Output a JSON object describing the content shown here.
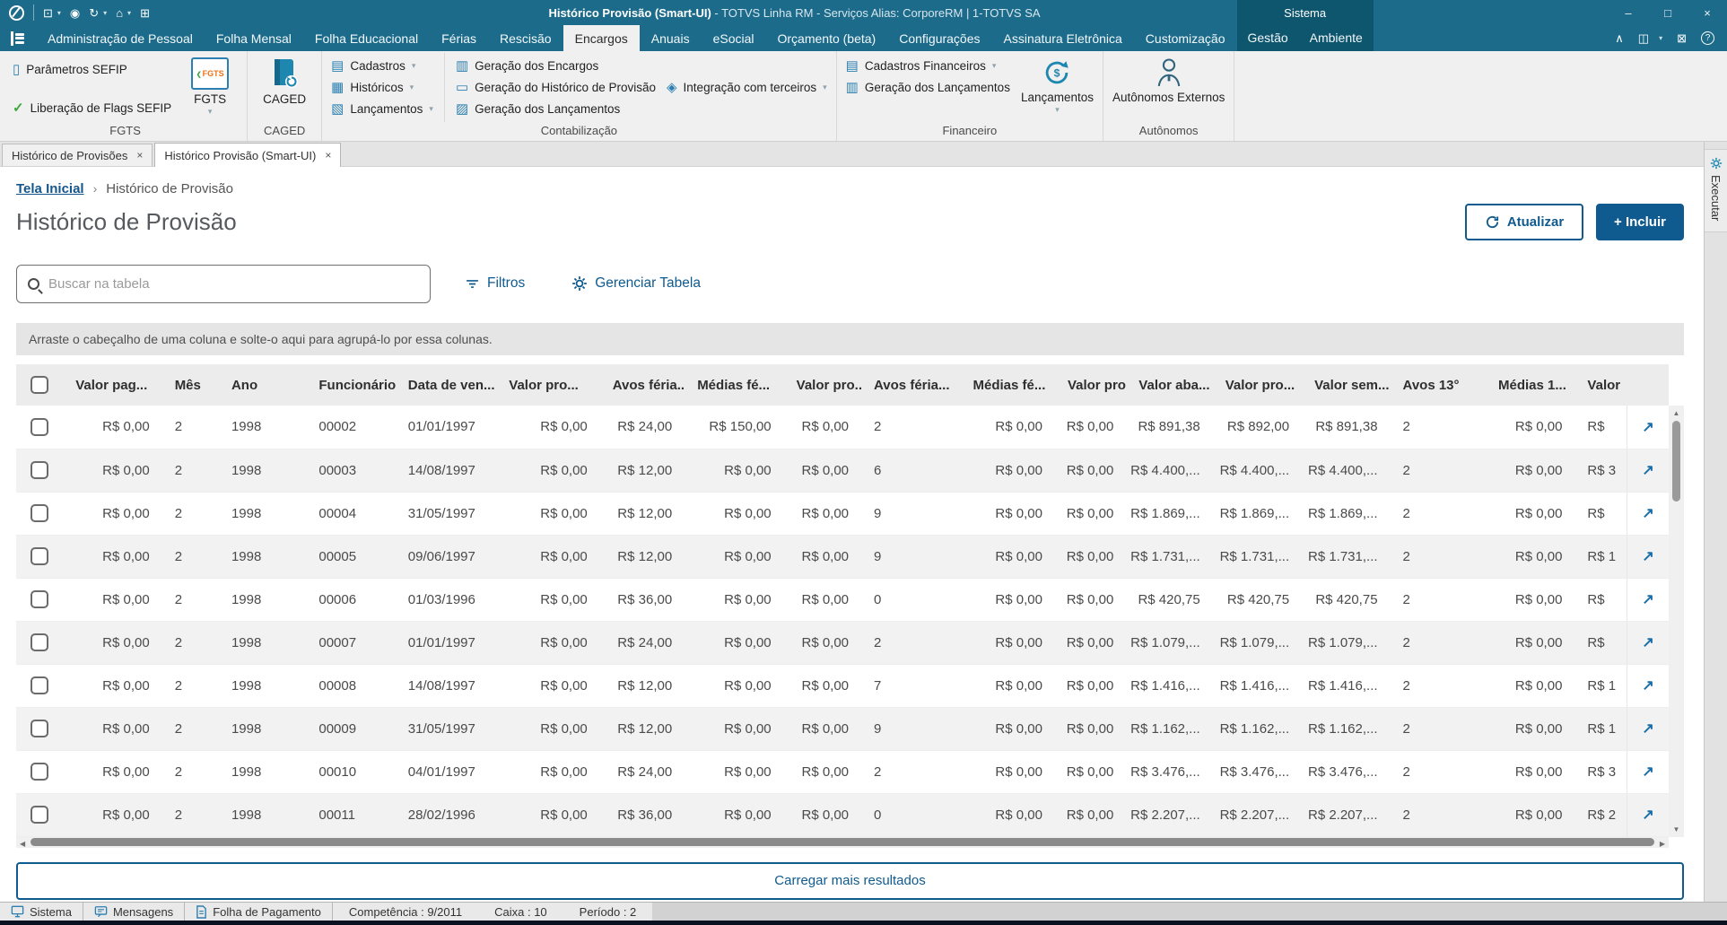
{
  "window": {
    "title_primary": "Histórico Provisão (Smart-UI)",
    "title_secondary": " - TOTVS Linha RM - Serviços  Alias: CorporeRM | 1-TOTVS SA"
  },
  "menubar": {
    "tabs": [
      "Administração de Pessoal",
      "Folha Mensal",
      "Folha Educacional",
      "Férias",
      "Rescisão",
      "Encargos",
      "Anuais",
      "eSocial",
      "Orçamento (beta)",
      "Configurações",
      "Assinatura Eletrônica",
      "Customização"
    ],
    "active_tab": "Encargos",
    "system_label": "Sistema",
    "system_tabs": [
      "Gestão",
      "Ambiente"
    ]
  },
  "ribbon": {
    "fgts": {
      "group_label": "FGTS",
      "item1": "Parâmetros SEFIP",
      "item2": "Liberação de Flags SEFIP",
      "big_label": "FGTS",
      "logo_text": "FGTS"
    },
    "caged": {
      "group_label": "CAGED",
      "big_label": "CAGED"
    },
    "contabilizacao": {
      "group_label": "Contabilização",
      "drop1": "Cadastros",
      "drop2": "Históricos",
      "drop3": "Lançamentos",
      "btn1": "Geração dos Encargos",
      "btn2": "Geração do Histórico de Provisão",
      "btn3": "Geração dos Lançamentos",
      "drop4": "Integração com terceiros"
    },
    "financeiro": {
      "group_label": "Financeiro",
      "drop1": "Cadastros Financeiros",
      "btn1": "Geração dos Lançamentos",
      "big_label": "Lançamentos"
    },
    "autonomos": {
      "group_label": "Autônomos",
      "big_label": "Autônomos Externos"
    }
  },
  "doc_tabs": [
    {
      "label": "Histórico de Provisões",
      "active": false
    },
    {
      "label": "Histórico Provisão (Smart-UI)",
      "active": true
    }
  ],
  "breadcrumb": {
    "home": "Tela Inicial",
    "current": "Histórico de Provisão"
  },
  "page": {
    "title": "Histórico de Provisão",
    "refresh_label": "Atualizar",
    "add_label": "+ Incluir"
  },
  "toolbar": {
    "search_placeholder": "Buscar na tabela",
    "filters_label": "Filtros",
    "manage_label": "Gerenciar Tabela"
  },
  "group_bar": "Arraste o cabeçalho de uma coluna e solte-o aqui para agrupá-lo por essa colunas.",
  "table": {
    "headers": [
      "Valor pag...",
      "Mês",
      "Ano",
      "Funcionário",
      "Data de ven...",
      "Valor pro...",
      "Avos féria...",
      "Médias fé...",
      "Valor pro...",
      "Avos féria...",
      "Médias fé...",
      "Valor pro...",
      "Valor aba...",
      "Valor pro...",
      "Valor sem...",
      "Avos 13°",
      "Médias 1...",
      "Valor"
    ],
    "money_columns": [
      0,
      5,
      6,
      7,
      8,
      10,
      11,
      12,
      13,
      14,
      16
    ],
    "rows": [
      [
        "R$ 0,00",
        "2",
        "1998",
        "00002",
        "01/01/1997",
        "R$ 0,00",
        "R$ 24,00",
        "R$ 150,00",
        "R$ 0,00",
        "2",
        "R$ 0,00",
        "R$ 0,00",
        "R$ 891,38",
        "R$ 892,00",
        "R$ 891,38",
        "2",
        "R$ 0,00",
        "R$"
      ],
      [
        "R$ 0,00",
        "2",
        "1998",
        "00003",
        "14/08/1997",
        "R$ 0,00",
        "R$ 12,00",
        "R$ 0,00",
        "R$ 0,00",
        "6",
        "R$ 0,00",
        "R$ 0,00",
        "R$ 4.400,...",
        "R$ 4.400,...",
        "R$ 4.400,...",
        "2",
        "R$ 0,00",
        "R$ 3"
      ],
      [
        "R$ 0,00",
        "2",
        "1998",
        "00004",
        "31/05/1997",
        "R$ 0,00",
        "R$ 12,00",
        "R$ 0,00",
        "R$ 0,00",
        "9",
        "R$ 0,00",
        "R$ 0,00",
        "R$ 1.869,...",
        "R$ 1.869,...",
        "R$ 1.869,...",
        "2",
        "R$ 0,00",
        "R$"
      ],
      [
        "R$ 0,00",
        "2",
        "1998",
        "00005",
        "09/06/1997",
        "R$ 0,00",
        "R$ 12,00",
        "R$ 0,00",
        "R$ 0,00",
        "9",
        "R$ 0,00",
        "R$ 0,00",
        "R$ 1.731,...",
        "R$ 1.731,...",
        "R$ 1.731,...",
        "2",
        "R$ 0,00",
        "R$ 1"
      ],
      [
        "R$ 0,00",
        "2",
        "1998",
        "00006",
        "01/03/1996",
        "R$ 0,00",
        "R$ 36,00",
        "R$ 0,00",
        "R$ 0,00",
        "0",
        "R$ 0,00",
        "R$ 0,00",
        "R$ 420,75",
        "R$ 420,75",
        "R$ 420,75",
        "2",
        "R$ 0,00",
        "R$"
      ],
      [
        "R$ 0,00",
        "2",
        "1998",
        "00007",
        "01/01/1997",
        "R$ 0,00",
        "R$ 24,00",
        "R$ 0,00",
        "R$ 0,00",
        "2",
        "R$ 0,00",
        "R$ 0,00",
        "R$ 1.079,...",
        "R$ 1.079,...",
        "R$ 1.079,...",
        "2",
        "R$ 0,00",
        "R$"
      ],
      [
        "R$ 0,00",
        "2",
        "1998",
        "00008",
        "14/08/1997",
        "R$ 0,00",
        "R$ 12,00",
        "R$ 0,00",
        "R$ 0,00",
        "7",
        "R$ 0,00",
        "R$ 0,00",
        "R$ 1.416,...",
        "R$ 1.416,...",
        "R$ 1.416,...",
        "2",
        "R$ 0,00",
        "R$ 1"
      ],
      [
        "R$ 0,00",
        "2",
        "1998",
        "00009",
        "31/05/1997",
        "R$ 0,00",
        "R$ 12,00",
        "R$ 0,00",
        "R$ 0,00",
        "9",
        "R$ 0,00",
        "R$ 0,00",
        "R$ 1.162,...",
        "R$ 1.162,...",
        "R$ 1.162,...",
        "2",
        "R$ 0,00",
        "R$ 1"
      ],
      [
        "R$ 0,00",
        "2",
        "1998",
        "00010",
        "04/01/1997",
        "R$ 0,00",
        "R$ 24,00",
        "R$ 0,00",
        "R$ 0,00",
        "2",
        "R$ 0,00",
        "R$ 0,00",
        "R$ 3.476,...",
        "R$ 3.476,...",
        "R$ 3.476,...",
        "2",
        "R$ 0,00",
        "R$ 3"
      ],
      [
        "R$ 0,00",
        "2",
        "1998",
        "00011",
        "28/02/1996",
        "R$ 0,00",
        "R$ 36,00",
        "R$ 0,00",
        "R$ 0,00",
        "0",
        "R$ 0,00",
        "R$ 0,00",
        "R$ 2.207,...",
        "R$ 2.207,...",
        "R$ 2.207,...",
        "2",
        "R$ 0,00",
        "R$ 2"
      ]
    ]
  },
  "load_more": "Carregar mais resultados",
  "statusbar": {
    "segments": [
      {
        "label": "Sistema",
        "icon": "monitor"
      },
      {
        "label": "Mensagens",
        "icon": "message"
      },
      {
        "label": "Folha de Pagamento",
        "icon": "payroll"
      }
    ],
    "info": [
      "Competência : 9/2011",
      "Caixa : 10",
      "Período : 2"
    ]
  },
  "side_panel": {
    "label": "Executar"
  },
  "colors": {
    "accent": "#0F5A8E",
    "header_teal": "#1C6B8A",
    "header_dark": "#0E556E",
    "icon_teal": "#2C7FB0",
    "link_blue": "#14568C",
    "row_alt": "#f2f2f2"
  }
}
